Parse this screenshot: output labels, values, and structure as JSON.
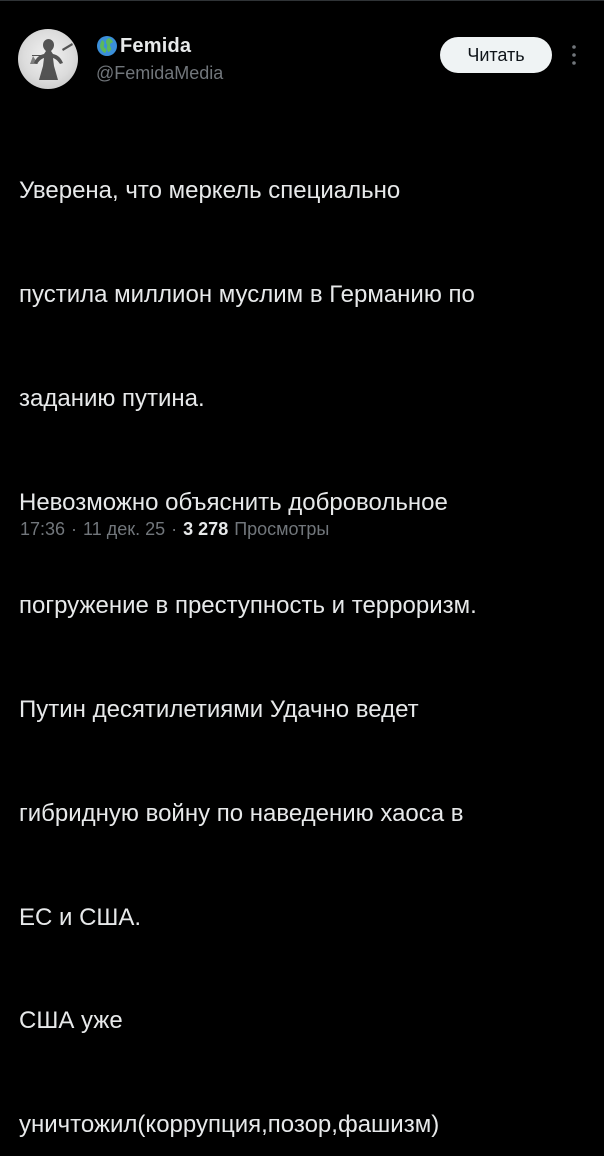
{
  "author": {
    "display_name": "Femida",
    "handle": "@FemidaMedia",
    "avatar_icon": "statue-avatar",
    "badge_icon": "globe-icon"
  },
  "follow_button": {
    "label": "Читать"
  },
  "more_icon": "more-vertical-icon",
  "post": {
    "lines": [
      "Уверена, что меркель специально",
      "пустила миллион муслим в Германию по",
      "заданию путина.",
      "Невозможно объяснить добровольное",
      "погружение в преступность и терроризм.",
      "Путин десятилетиями Удачно ведет",
      "гибридную войну по наведению хаоса в",
      "ЕС и США.",
      "США уже",
      "уничтожил(коррупция,позор,фашизм)"
    ]
  },
  "meta": {
    "time": "17:36",
    "date": "11 дек. 25",
    "separator": "·",
    "views_count": "3 278",
    "views_label": "Просмотры"
  },
  "colors": {
    "background": "#000000",
    "text": "#e7e9ea",
    "secondary_text": "#71767b",
    "button_bg": "#eff3f4",
    "selection_cursor": "#1d4f91"
  }
}
